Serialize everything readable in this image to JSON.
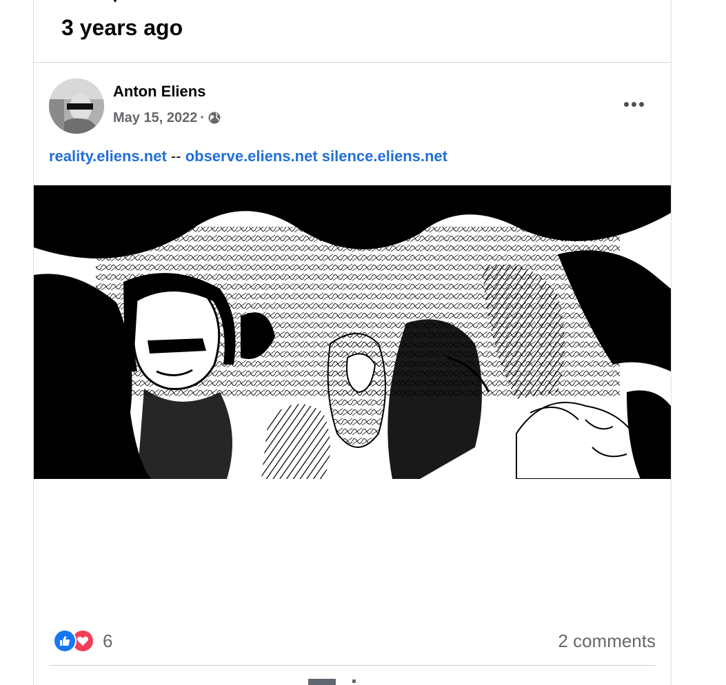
{
  "memory": {
    "title": "3 years ago"
  },
  "post": {
    "author": "Anton Eliens",
    "date": "May 15, 2022",
    "separator": "·",
    "privacy_icon": "globe-icon",
    "more_icon": "more-options-icon",
    "links": [
      {
        "text": "reality.eliens.net"
      },
      {
        "text": "observe.eliens.net"
      },
      {
        "text": "silence.eliens.net"
      }
    ],
    "link_separator": "--",
    "link_color": "#216fdb"
  },
  "engagement": {
    "reaction_icons": [
      "like-icon",
      "love-icon"
    ],
    "reaction_count": "6",
    "comments_label": "2 comments",
    "like_color": "#1877f2",
    "love_color": "#f33e58"
  }
}
